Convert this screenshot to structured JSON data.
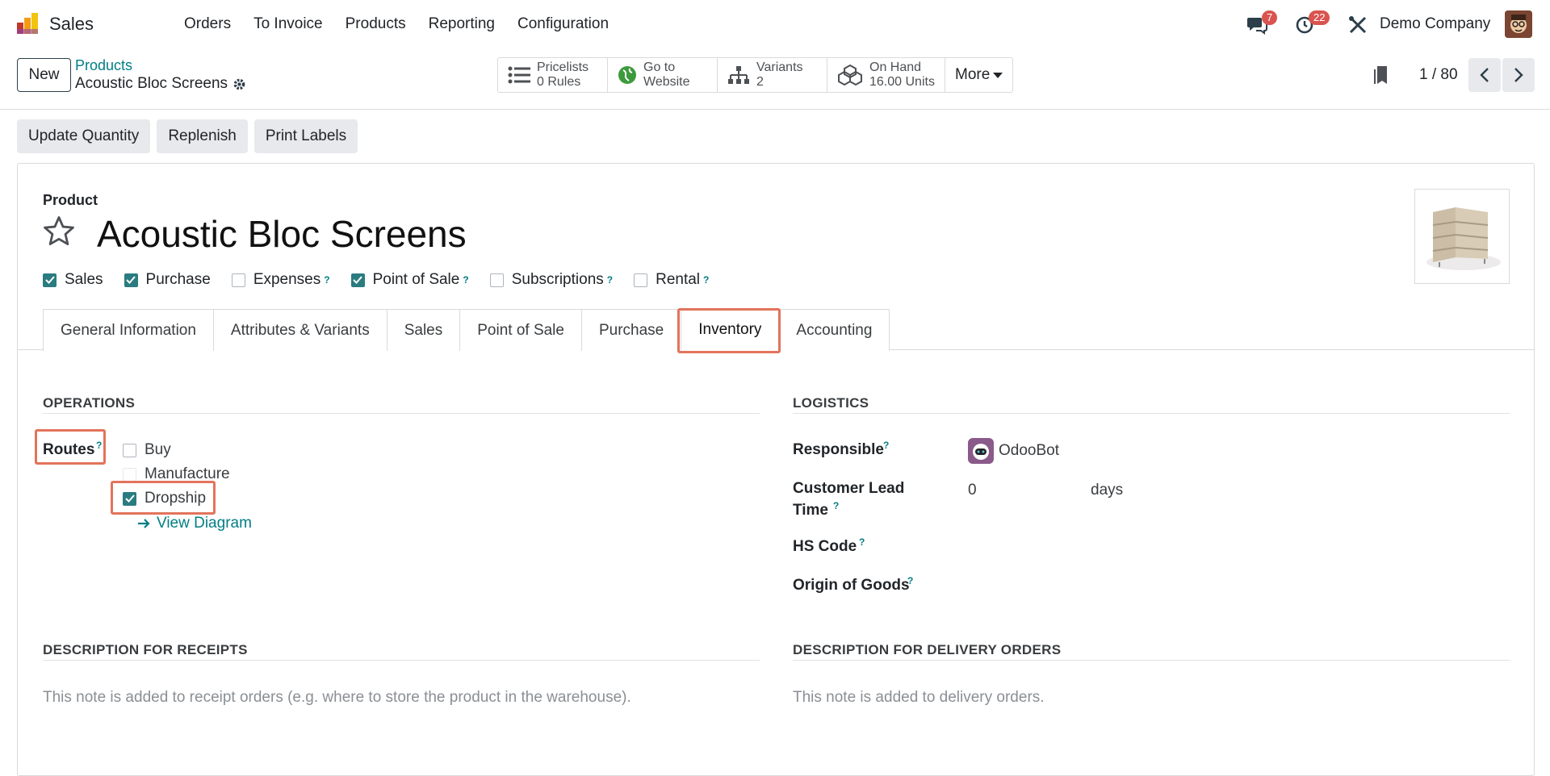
{
  "nav": {
    "app_name": "Sales",
    "menu": [
      "Orders",
      "To Invoice",
      "Products",
      "Reporting",
      "Configuration"
    ],
    "messages_count": "7",
    "activities_count": "22",
    "company": "Demo Company"
  },
  "control": {
    "new_label": "New",
    "breadcrumb_parent": "Products",
    "breadcrumb_current": "Acoustic Bloc Screens",
    "smart_buttons": [
      {
        "title": "Pricelists",
        "value": "0  Rules",
        "icon": "list-icon"
      },
      {
        "title": "Go to",
        "value": "Website",
        "icon": "globe-icon"
      },
      {
        "title": "Variants",
        "value": "2",
        "icon": "sitemap-icon"
      },
      {
        "title": "On Hand",
        "value": "16.00 Units",
        "icon": "cubes-icon"
      }
    ],
    "more_label": "More",
    "pager": "1 / 80"
  },
  "actions": [
    "Update Quantity",
    "Replenish",
    "Print Labels"
  ],
  "product": {
    "label": "Product",
    "name": "Acoustic Bloc Screens",
    "flags": [
      {
        "label": "Sales",
        "checked": true,
        "help": false
      },
      {
        "label": "Purchase",
        "checked": true,
        "help": false
      },
      {
        "label": "Expenses",
        "checked": false,
        "help": true
      },
      {
        "label": "Point of Sale",
        "checked": true,
        "help": true
      },
      {
        "label": "Subscriptions",
        "checked": false,
        "help": true
      },
      {
        "label": "Rental",
        "checked": false,
        "help": true
      }
    ]
  },
  "tabs": [
    "General Information",
    "Attributes & Variants",
    "Sales",
    "Point of Sale",
    "Purchase",
    "Inventory",
    "Accounting"
  ],
  "active_tab": "Inventory",
  "operations": {
    "title": "OPERATIONS",
    "routes_label": "Routes",
    "routes": [
      {
        "label": "Buy",
        "checked": false
      },
      {
        "label": "Manufacture",
        "checked": false
      },
      {
        "label": "Dropship",
        "checked": true
      }
    ],
    "view_diagram": "View Diagram"
  },
  "logistics": {
    "title": "LOGISTICS",
    "responsible_label": "Responsible",
    "responsible_value": "OdooBot",
    "lead_time_label_1": "Customer Lead",
    "lead_time_label_2": "Time",
    "lead_time_value": "0",
    "lead_time_unit": "days",
    "hs_code_label": "HS Code",
    "origin_label": "Origin of Goods"
  },
  "descriptions": {
    "receipts_title": "DESCRIPTION FOR RECEIPTS",
    "receipts_placeholder": "This note is added to receipt orders (e.g. where to store the product in the warehouse).",
    "delivery_title": "DESCRIPTION FOR DELIVERY ORDERS",
    "delivery_placeholder": "This note is added to delivery orders."
  },
  "help_mark": "?",
  "highlight_color": "#e2735b",
  "accent_color": "#017e84"
}
